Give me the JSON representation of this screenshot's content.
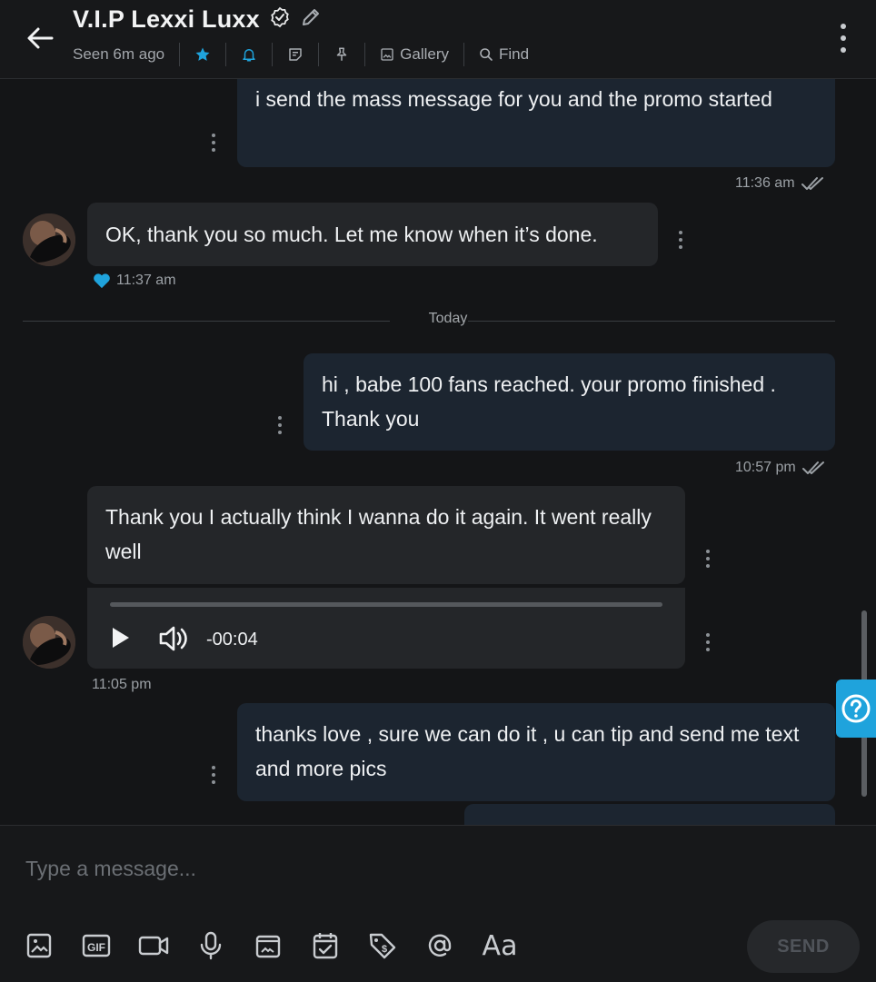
{
  "header": {
    "title": "V.I.P Lexxi Luxx",
    "seen": "Seen 6m ago",
    "gallery_label": "Gallery",
    "find_label": "Find"
  },
  "messages": [
    {
      "dir": "out",
      "text": "i send the mass message for you and the promo started",
      "time": "11:36 am",
      "status": "read-double-check"
    },
    {
      "dir": "in",
      "text": "OK, thank you so much. Let me know when it’s done.",
      "time": "11:37 am",
      "liked": true
    },
    {
      "dir": "out",
      "text": "hi , babe 100 fans reached. your promo finished . Thank you",
      "time": "10:57 pm",
      "status": "read-double-check"
    },
    {
      "dir": "in",
      "text": "Thank you I actually think I wanna do it again. It went really well",
      "audio_duration": "-00:04",
      "time": "11:05 pm"
    },
    {
      "dir": "out",
      "text": "thanks love , sure we can do it , u can tip and send me text and more pics"
    }
  ],
  "divider": {
    "label": "Today"
  },
  "composer": {
    "placeholder": "Type a message...",
    "send_label": "SEND",
    "format_label": "Aa",
    "gif_label": "GIF"
  },
  "colors": {
    "accent": "#1fa3dc",
    "outgoing_bubble": "#1c2530",
    "incoming_bubble": "#242629",
    "background": "#141517"
  },
  "icons": [
    "back-arrow-icon",
    "verified-icon",
    "edit-pencil-icon",
    "star-icon",
    "bell-icon",
    "notes-icon",
    "pin-icon",
    "gallery-icon",
    "search-icon",
    "more-vertical-icon",
    "heart-icon",
    "double-check-icon",
    "play-icon",
    "volume-icon",
    "help-icon",
    "image-icon",
    "gif-icon",
    "video-icon",
    "microphone-icon",
    "vault-icon",
    "calendar-check-icon",
    "price-tag-icon",
    "mention-icon"
  ]
}
